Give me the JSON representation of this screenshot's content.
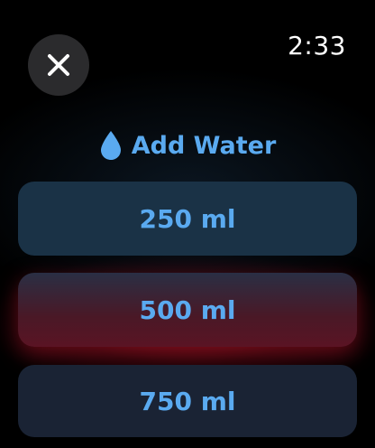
{
  "status_bar": {
    "time": "2:33"
  },
  "header": {
    "icon": "water-drop-icon",
    "title": "Add Water"
  },
  "options": [
    {
      "label": "250 ml"
    },
    {
      "label": "500 ml"
    },
    {
      "label": "750 ml"
    }
  ],
  "colors": {
    "accent": "#5aaaf0",
    "background": "#000000",
    "close_button": "#2b2b2d",
    "highlight": "#b01428"
  }
}
